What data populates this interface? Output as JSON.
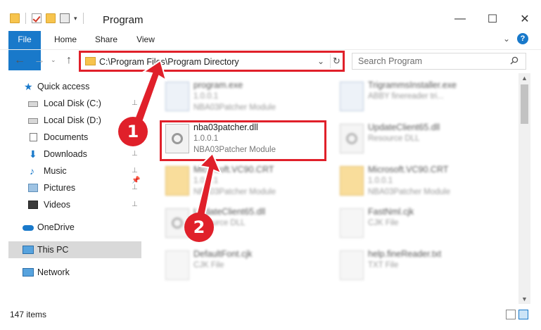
{
  "window": {
    "title": "Program",
    "controls": {
      "minimize": "—",
      "maximize": "☐",
      "close": "✕"
    },
    "quick_access_chevron": "▾"
  },
  "ribbon": {
    "tabs": [
      {
        "label": "File",
        "active": true
      },
      {
        "label": "Home"
      },
      {
        "label": "Share"
      },
      {
        "label": "View"
      }
    ],
    "expand_chevron": "⌄",
    "help": "?"
  },
  "nav": {
    "back": "←",
    "forward": "→",
    "history": "⌄",
    "up": "↑"
  },
  "address_bar": {
    "path": "C:\\Program Files\\Program Directory",
    "dropdown": "⌄",
    "refresh": "↻"
  },
  "search": {
    "placeholder": "Search Program"
  },
  "sidebar": {
    "items": [
      {
        "label": "Quick access",
        "icon": "star-icon",
        "pinned": false
      },
      {
        "label": "Local Disk (C:)",
        "icon": "disk-icon",
        "pinned": true
      },
      {
        "label": "Local Disk (D:)",
        "icon": "disk-icon",
        "pinned": true
      },
      {
        "label": "Documents",
        "icon": "documents-icon",
        "pinned": true
      },
      {
        "label": "Downloads",
        "icon": "downloads-icon",
        "pinned": true
      },
      {
        "label": "Music",
        "icon": "music-icon",
        "pinned": true
      },
      {
        "label": "Pictures",
        "icon": "pictures-icon",
        "pinned": true
      },
      {
        "label": "Videos",
        "icon": "videos-icon",
        "pinned": true
      },
      {
        "label": "OneDrive",
        "icon": "onedrive-icon",
        "pinned": false
      },
      {
        "label": "This PC",
        "icon": "this-pc-icon",
        "pinned": false,
        "selected": true
      },
      {
        "label": "Network",
        "icon": "network-icon",
        "pinned": false
      }
    ],
    "pin_glyph": "📌"
  },
  "files": [
    {
      "name": "program.exe",
      "version": "1.0.0.1",
      "description": "NBA03Patcher Module",
      "type": "exe",
      "blurred": true
    },
    {
      "name": "TrigrammsInstaller.exe",
      "version": "",
      "description": "ABBY finereader tri...",
      "type": "exe",
      "blurred": true
    },
    {
      "name": "nba03patcher.dll",
      "version": "1.0.0.1",
      "description": "NBA03Patcher Module",
      "type": "dll",
      "blurred": false
    },
    {
      "name": "UpdateClient65.dll",
      "version": "",
      "description": "Resource DLL",
      "type": "dll",
      "blurred": true
    },
    {
      "name": "Microsoft.VC90.CRT",
      "version": "1.0.0.1",
      "description": "NBA03Patcher Module",
      "type": "folder",
      "blurred": true
    },
    {
      "name": "Microsoft.VC90.CRT",
      "version": "1.0.0.1",
      "description": "NBA03Patcher Module",
      "type": "folder",
      "blurred": true
    },
    {
      "name": "UpdateClient65.dll",
      "version": "",
      "description": "Resource DLL",
      "type": "dll",
      "blurred": true
    },
    {
      "name": "FastNml.cjk",
      "version": "",
      "description": "CJK File",
      "type": "file",
      "blurred": true
    },
    {
      "name": "DefaultFont.cjk",
      "version": "",
      "description": "CJK File",
      "type": "file",
      "blurred": true
    },
    {
      "name": "help.fineReader.txt",
      "version": "",
      "description": "TXT File",
      "type": "file",
      "blurred": true
    }
  ],
  "scrollbar": {
    "up": "▲",
    "down": "▼"
  },
  "status": {
    "item_count": "147 items"
  },
  "annotations": {
    "step1": "1",
    "step2": "2",
    "color": "#e0202a"
  },
  "colors": {
    "accent": "#1979ca",
    "highlight": "#e0202a",
    "selected": "#d9d9d9"
  }
}
